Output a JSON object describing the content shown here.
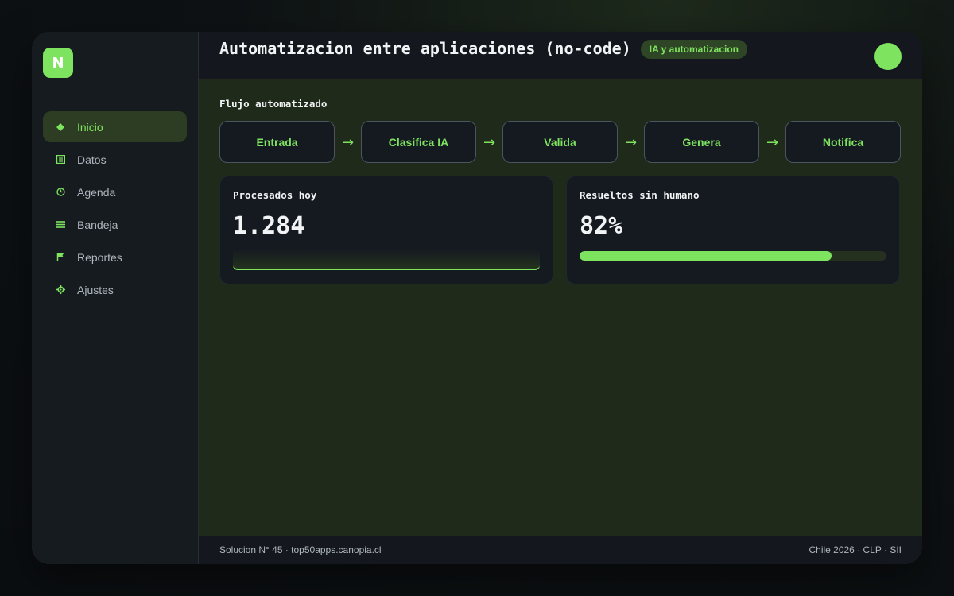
{
  "app": {
    "logo_letter": "N",
    "accent": "#7ee35f"
  },
  "sidebar": {
    "items": [
      {
        "label": "Inicio",
        "icon": "diamond-icon",
        "active": true
      },
      {
        "label": "Datos",
        "icon": "document-icon",
        "active": false
      },
      {
        "label": "Agenda",
        "icon": "clock-icon",
        "active": false
      },
      {
        "label": "Bandeja",
        "icon": "list-icon",
        "active": false
      },
      {
        "label": "Reportes",
        "icon": "flag-icon",
        "active": false
      },
      {
        "label": "Ajustes",
        "icon": "gear-icon",
        "active": false
      }
    ]
  },
  "header": {
    "title": "Automatizacion entre aplicaciones (no-code)",
    "badge": "IA y automatizacion"
  },
  "flow": {
    "title": "Flujo automatizado",
    "steps": [
      "Entrada",
      "Clasifica IA",
      "Valida",
      "Genera",
      "Notifica"
    ],
    "arrow": "→"
  },
  "stats": [
    {
      "label": "Procesados hoy",
      "value": "1.284"
    },
    {
      "label": "Resueltos sin humano",
      "value": "82%",
      "progress": 0.82
    }
  ],
  "footer": {
    "left": "Solucion N° 45 · top50apps.canopia.cl",
    "right": "Chile 2026 · CLP · SII"
  }
}
